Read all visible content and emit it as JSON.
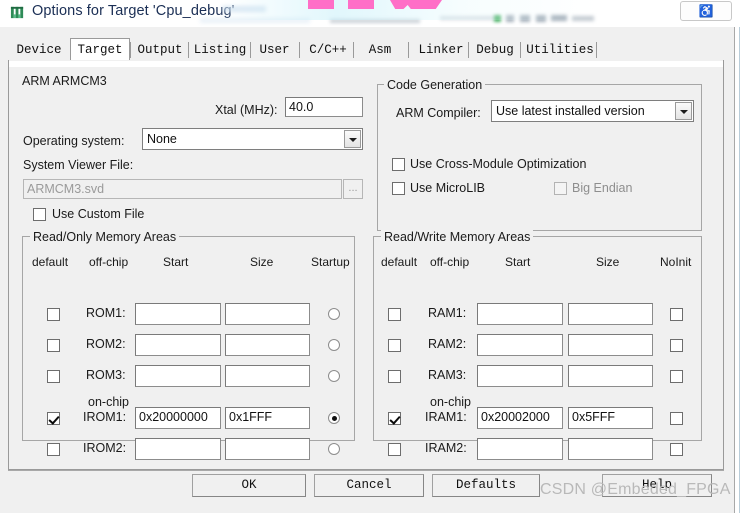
{
  "window": {
    "title": "Options for Target 'Cpu_debug'",
    "icon": "keil-uvision-icon",
    "help_button": "help-sash-icon"
  },
  "tabs": [
    {
      "label": "Device",
      "selected": false
    },
    {
      "label": "Target",
      "selected": true
    },
    {
      "label": "Output",
      "selected": false
    },
    {
      "label": "Listing",
      "selected": false
    },
    {
      "label": "User",
      "selected": false
    },
    {
      "label": "C/C++",
      "selected": false
    },
    {
      "label": "Asm",
      "selected": false
    },
    {
      "label": "Linker",
      "selected": false
    },
    {
      "label": "Debug",
      "selected": false
    },
    {
      "label": "Utilities",
      "selected": false
    }
  ],
  "target": {
    "device_name": "ARM ARMCM3",
    "xtal_label": "Xtal (MHz):",
    "xtal_value": "40.0",
    "os_label": "Operating system:",
    "os_value": "None",
    "svf_label": "System Viewer File:",
    "svf_value": "ARMCM3.svd",
    "svf_browse": "...",
    "use_custom_file_label": "Use Custom File",
    "use_custom_file_checked": false
  },
  "code_generation": {
    "title": "Code Generation",
    "compiler_label": "ARM Compiler:",
    "compiler_value": "Use latest installed version",
    "cross_module_label": "Use Cross-Module Optimization",
    "cross_module_checked": false,
    "microlib_label": "Use MicroLIB",
    "microlib_checked": false,
    "big_endian_label": "Big Endian",
    "big_endian_checked": false,
    "big_endian_disabled": true
  },
  "read_only_memory": {
    "title": "Read/Only Memory Areas",
    "headers": {
      "default": "default",
      "chip": "off-chip",
      "start": "Start",
      "size": "Size",
      "last": "Startup"
    },
    "onchip_label": "on-chip",
    "rows": [
      {
        "name": "ROM1:",
        "checked": false,
        "start": "",
        "size": "",
        "startup": false
      },
      {
        "name": "ROM2:",
        "checked": false,
        "start": "",
        "size": "",
        "startup": false
      },
      {
        "name": "ROM3:",
        "checked": false,
        "start": "",
        "size": "",
        "startup": false
      },
      {
        "name": "IROM1:",
        "checked": true,
        "start": "0x20000000",
        "size": "0x1FFF",
        "startup": true
      },
      {
        "name": "IROM2:",
        "checked": false,
        "start": "",
        "size": "",
        "startup": false
      }
    ]
  },
  "read_write_memory": {
    "title": "Read/Write Memory Areas",
    "headers": {
      "default": "default",
      "chip": "off-chip",
      "start": "Start",
      "size": "Size",
      "last": "NoInit"
    },
    "onchip_label": "on-chip",
    "rows": [
      {
        "name": "RAM1:",
        "checked": false,
        "start": "",
        "size": "",
        "noinit": false
      },
      {
        "name": "RAM2:",
        "checked": false,
        "start": "",
        "size": "",
        "noinit": false
      },
      {
        "name": "RAM3:",
        "checked": false,
        "start": "",
        "size": "",
        "noinit": false
      },
      {
        "name": "IRAM1:",
        "checked": true,
        "start": "0x20002000",
        "size": "0x5FFF",
        "noinit": false
      },
      {
        "name": "IRAM2:",
        "checked": false,
        "start": "",
        "size": "",
        "noinit": false
      }
    ]
  },
  "buttons": {
    "ok": "OK",
    "cancel": "Cancel",
    "defaults": "Defaults",
    "help": "Help"
  },
  "watermark": "CSDN @Embeded_FPGA"
}
